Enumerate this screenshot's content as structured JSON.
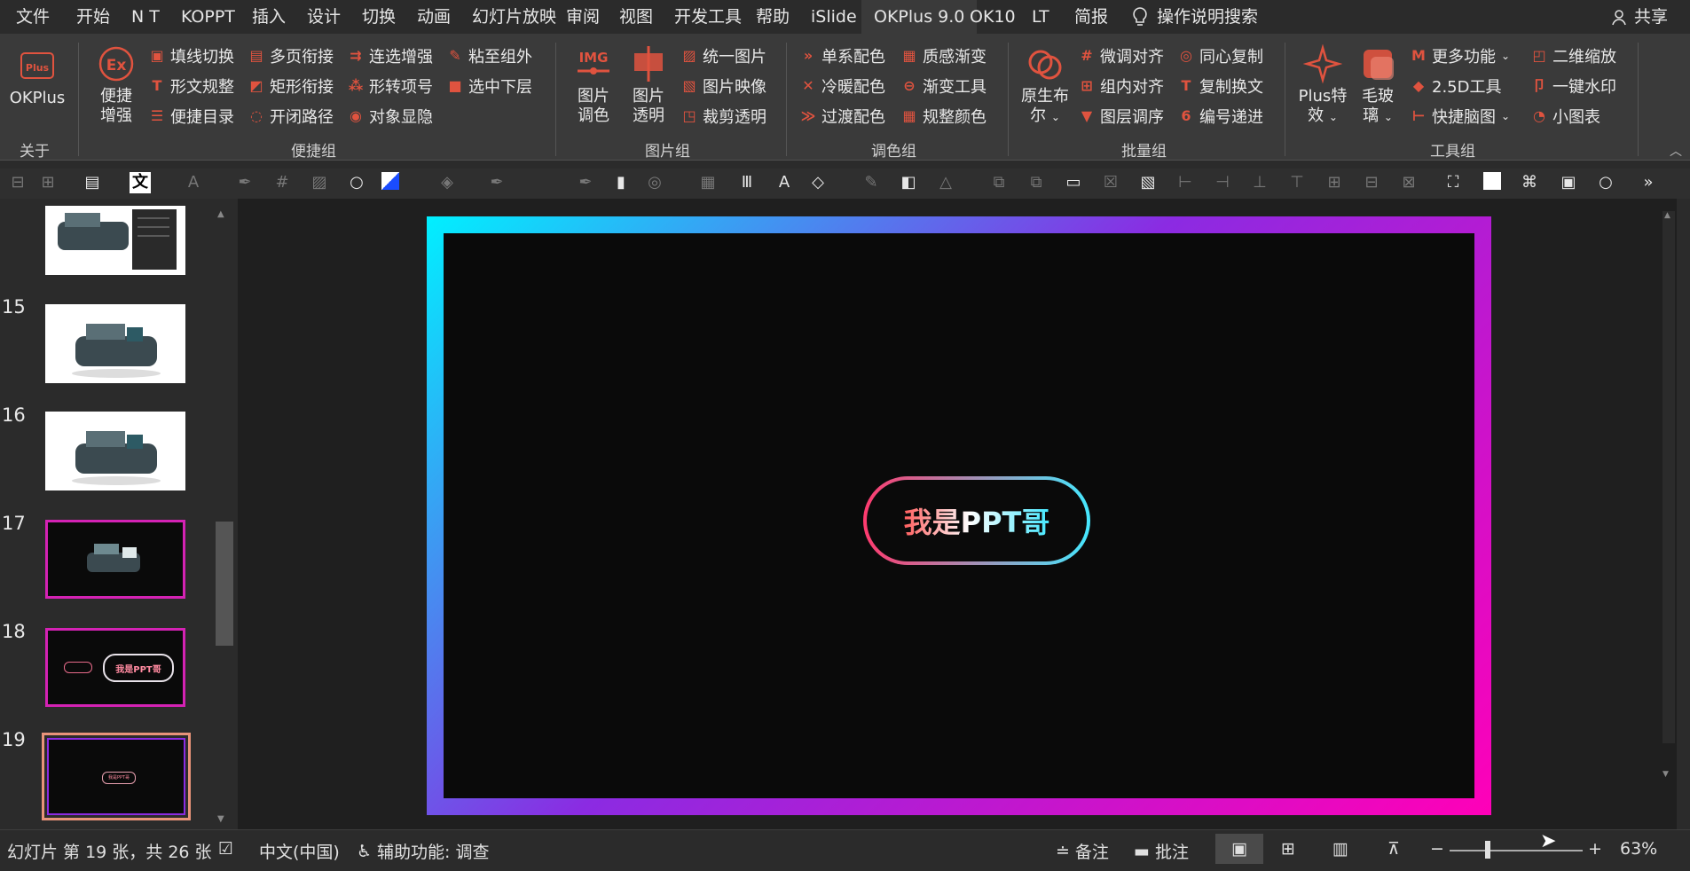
{
  "tabs": [
    "文件",
    "开始",
    "N T",
    "KOPPT",
    "插入",
    "设计",
    "切换",
    "动画",
    "幻灯片放映",
    "审阅",
    "视图",
    "开发工具",
    "帮助",
    "iSlide",
    "OKPlus 9.0",
    "OK10",
    "LT",
    "简报"
  ],
  "active_tab": "OKPlus 9.0",
  "search_label": "操作说明搜索",
  "share_label": "共享",
  "ribbon": {
    "okplus_label": "OKPlus",
    "about_group": "关于",
    "convenient": {
      "big_label_1": "便捷",
      "big_label_2": "增强",
      "items": [
        "填线切换",
        "多页衔接",
        "连选增强",
        "粘至组外",
        "形文规整",
        "矩形衔接",
        "形转项号",
        "选中下层",
        "便捷目录",
        "开闭路径",
        "对象显隐"
      ],
      "group": "便捷组"
    },
    "picture": {
      "big1_a": "图片",
      "big1_b": "调色",
      "big2_a": "图片",
      "big2_b": "透明",
      "items": [
        "统一图片",
        "图片映像",
        "裁剪透明"
      ],
      "group": "图片组",
      "img_text": "IMG"
    },
    "color": {
      "items": [
        "单系配色",
        "质感渐变",
        "冷暖配色",
        "渐变工具",
        "过渡配色",
        "规整颜色"
      ],
      "group": "调色组"
    },
    "batch": {
      "big_a": "原生布",
      "big_b": "尔",
      "items": [
        "微调对齐",
        "同心复制",
        "组内对齐",
        "复制换文",
        "图层调序",
        "编号递进"
      ],
      "group": "批量组"
    },
    "tools": {
      "big1_a": "Plus特",
      "big1_b": "效",
      "big2_a": "毛玻",
      "big2_b": "璃",
      "items": [
        "更多功能",
        "二维缩放",
        "2.5D工具",
        "一键水印",
        "快捷脑图",
        "小图表"
      ],
      "group": "工具组"
    }
  },
  "thumbnails": [
    {
      "num": "",
      "kind": "machine-panel"
    },
    {
      "num": "15",
      "kind": "machine"
    },
    {
      "num": "16",
      "kind": "machine"
    },
    {
      "num": "17",
      "kind": "machine-dark"
    },
    {
      "num": "18",
      "kind": "pill-dark",
      "text": "我是PPT哥"
    },
    {
      "num": "19",
      "kind": "pill-small",
      "text": "我是PPT哥"
    }
  ],
  "slide": {
    "pill_text": "我是PPT哥",
    "gradient_colors": [
      "#00f0ff",
      "#8b2be2",
      "#ff00b8"
    ]
  },
  "status": {
    "slide_info": "幻灯片 第 19 张，共 26 张",
    "language": "中文(中国)",
    "accessibility": "辅助功能: 调查",
    "notes": "备注",
    "comments": "批注",
    "zoom": "63%",
    "zoom_minus": "−",
    "zoom_plus": "+"
  }
}
